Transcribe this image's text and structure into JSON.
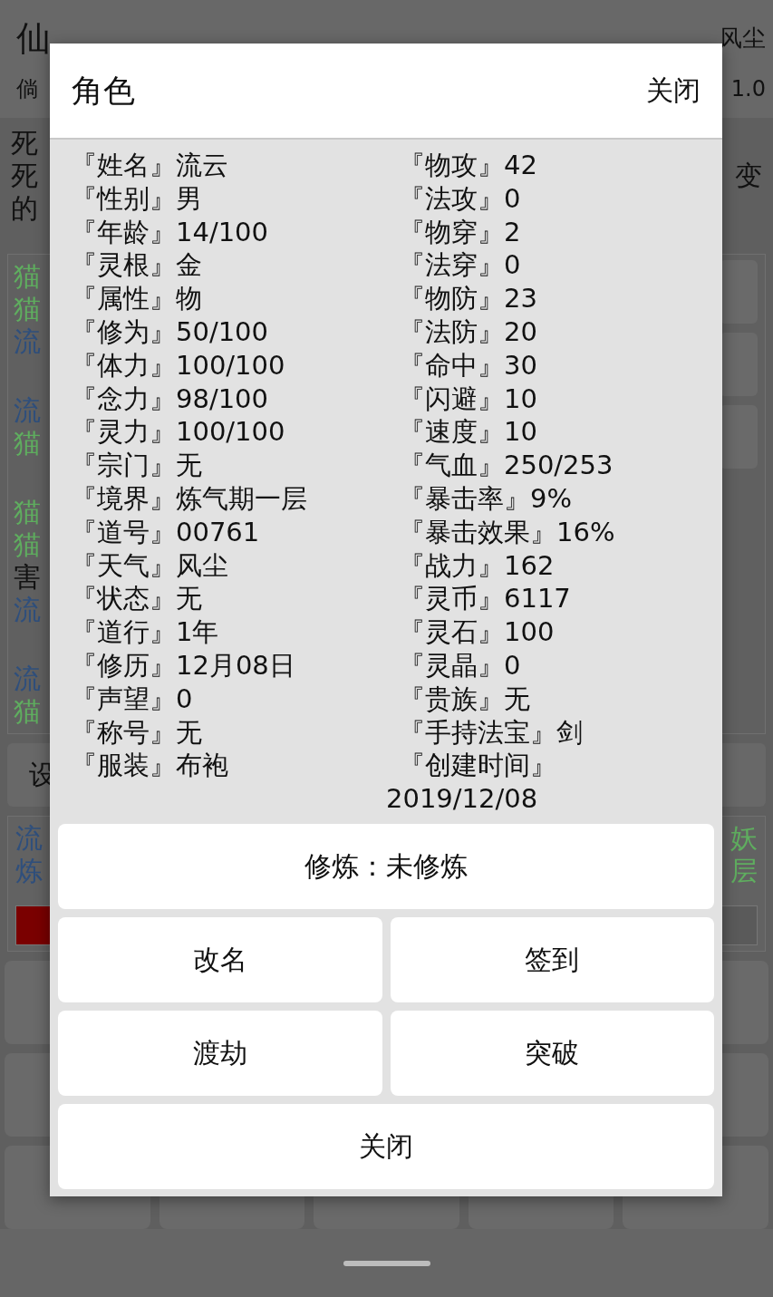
{
  "background": {
    "app_title": "仙",
    "weather": "风尘",
    "subtitle": "倘",
    "version": "1.0",
    "log_left": [
      "死",
      "死",
      "的"
    ],
    "log_right": "变",
    "battle_log": [
      [
        {
          "text": "猫",
          "kind": "monster"
        },
        {
          "text": "猫",
          "kind": "monster"
        },
        {
          "text": "流",
          "kind": "player"
        }
      ],
      [
        {
          "text": "流",
          "kind": "player"
        },
        {
          "text": "猫",
          "kind": "monster"
        }
      ],
      [
        {
          "text": "猫",
          "kind": "monster"
        },
        {
          "text": "猫",
          "kind": "monster"
        },
        {
          "text": "害",
          "kind": "plain"
        },
        {
          "text": "流",
          "kind": "player"
        }
      ],
      [
        {
          "text": "流",
          "kind": "player"
        },
        {
          "text": "猫",
          "kind": "monster"
        }
      ]
    ],
    "settings_label": "设",
    "info_left": [
      "流",
      "炼"
    ],
    "info_right": [
      "妖",
      "层"
    ]
  },
  "dialog": {
    "title": "角色",
    "close_link": "关闭",
    "left_stats": [
      {
        "label": "『姓名』",
        "value": "流云"
      },
      {
        "label": "『性别』",
        "value": "男"
      },
      {
        "label": "『年龄』",
        "value": "14/100"
      },
      {
        "label": "『灵根』",
        "value": "金"
      },
      {
        "label": "『属性』",
        "value": "物"
      },
      {
        "label": "『修为』",
        "value": "50/100"
      },
      {
        "label": "『体力』",
        "value": "100/100"
      },
      {
        "label": "『念力』",
        "value": "98/100"
      },
      {
        "label": "『灵力』",
        "value": "100/100"
      },
      {
        "label": "『宗门』",
        "value": "无"
      },
      {
        "label": "『境界』",
        "value": "炼气期一层"
      },
      {
        "label": "『道号』",
        "value": "00761"
      },
      {
        "label": "『天气』",
        "value": "风尘"
      },
      {
        "label": "『状态』",
        "value": "无"
      },
      {
        "label": "『道行』",
        "value": "1年"
      },
      {
        "label": "『修历』",
        "value": "12月08日"
      },
      {
        "label": "『声望』",
        "value": "0"
      },
      {
        "label": "『称号』",
        "value": "无"
      },
      {
        "label": "『服装』",
        "value": "布袍"
      }
    ],
    "right_stats": [
      {
        "label": "『物攻』",
        "value": "42"
      },
      {
        "label": "『法攻』",
        "value": "0"
      },
      {
        "label": "『物穿』",
        "value": "2"
      },
      {
        "label": "『法穿』",
        "value": "0"
      },
      {
        "label": "『物防』",
        "value": "23"
      },
      {
        "label": "『法防』",
        "value": "20"
      },
      {
        "label": "『命中』",
        "value": "30"
      },
      {
        "label": "『闪避』",
        "value": "10"
      },
      {
        "label": "『速度』",
        "value": "10"
      },
      {
        "label": "『气血』",
        "value": "250/253"
      },
      {
        "label": "『暴击率』",
        "value": "9%"
      },
      {
        "label": "『暴击效果』",
        "value": "16%"
      },
      {
        "label": "『战力』",
        "value": "162"
      },
      {
        "label": "『灵币』",
        "value": "6117"
      },
      {
        "label": "『灵石』",
        "value": "100"
      },
      {
        "label": "『灵晶』",
        "value": "0"
      },
      {
        "label": "『贵族』",
        "value": "无"
      },
      {
        "label": "『手持法宝』",
        "value": "剑"
      },
      {
        "label": "『创建时间』",
        "value": "2019/12/08",
        "wrap": true
      }
    ],
    "cultivate_button": "修炼：未修炼",
    "action_buttons": [
      "改名",
      "签到",
      "渡劫",
      "突破"
    ],
    "close_button": "关闭"
  }
}
